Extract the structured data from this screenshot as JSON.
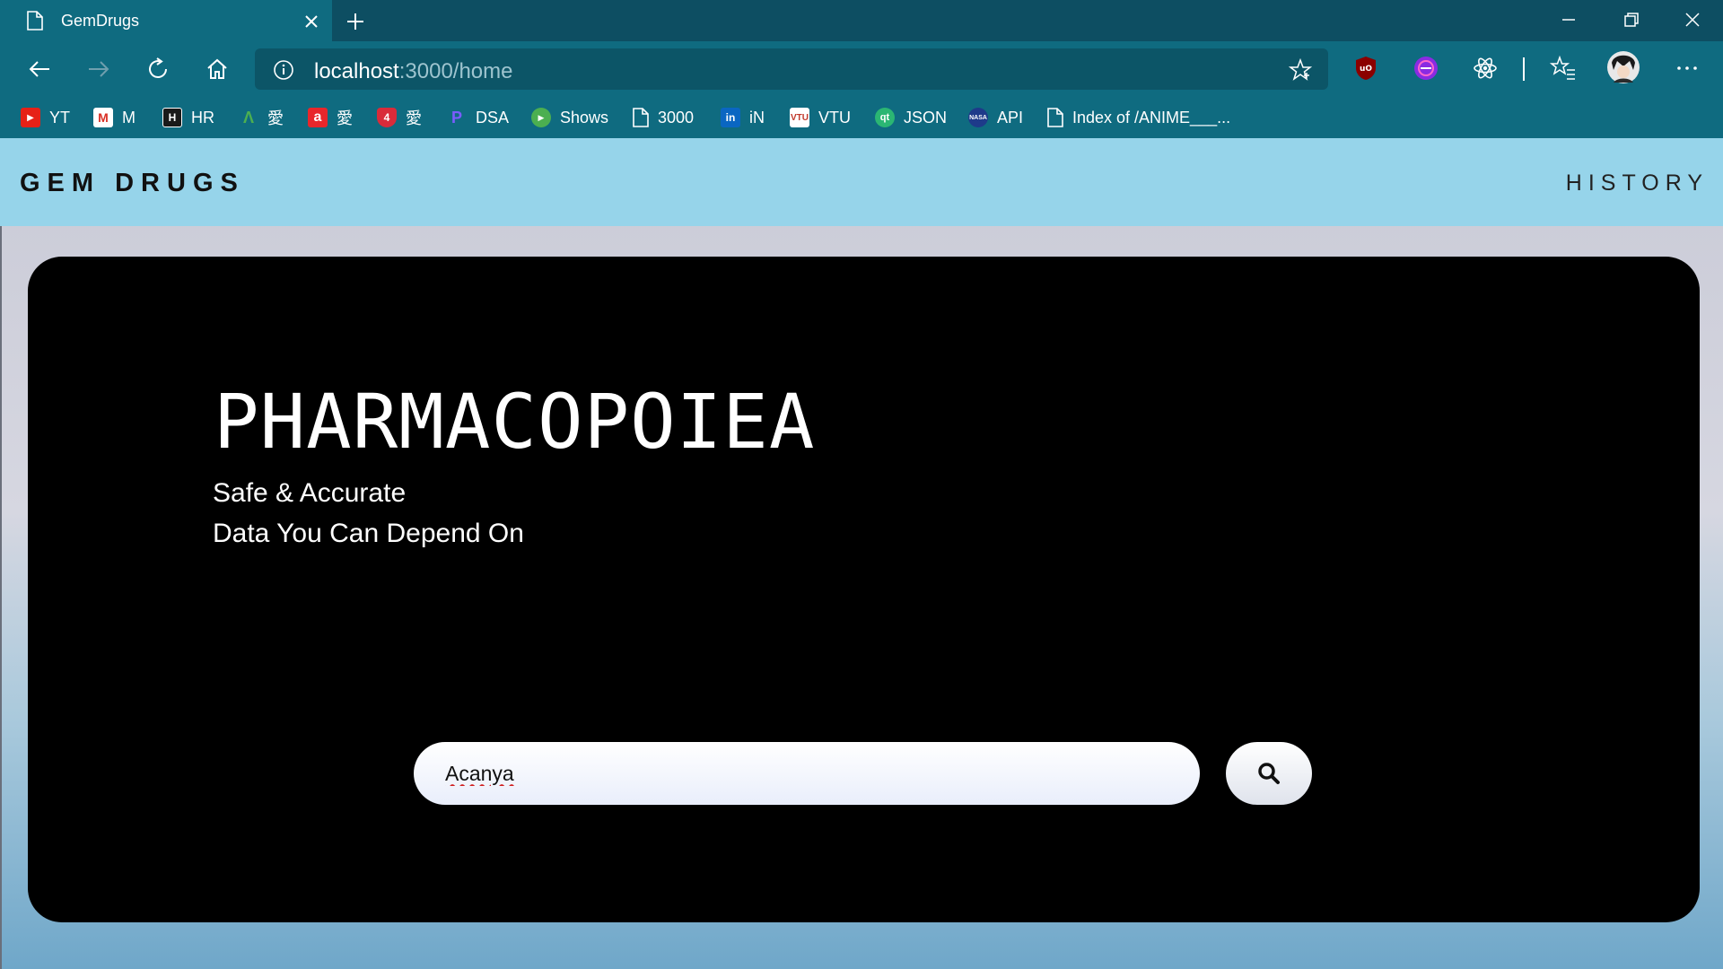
{
  "browser": {
    "tab_title": "GemDrugs",
    "url_host": "localhost",
    "url_path": ":3000/home",
    "bookmarks": [
      {
        "label": "YT",
        "icon": "youtube-icon",
        "color": "#e62117",
        "glyph": "▶"
      },
      {
        "label": "M",
        "icon": "gmail-icon",
        "color": "#ffffff",
        "glyph": "M"
      },
      {
        "label": "HR",
        "icon": "hackerrank-icon",
        "color": "#1a1a1a",
        "glyph": "H"
      },
      {
        "label": "愛",
        "icon": "anime-a-icon",
        "color": "#2a7a4a",
        "glyph": "Λ"
      },
      {
        "label": "愛",
        "icon": "anime-red-a-icon",
        "color": "#e8262b",
        "glyph": "a"
      },
      {
        "label": "愛",
        "icon": "anime-shield-icon",
        "color": "#d92b3a",
        "glyph": "4"
      },
      {
        "label": "DSA",
        "icon": "dsa-icon",
        "color": "#5a3ad8",
        "glyph": "P"
      },
      {
        "label": "Shows",
        "icon": "shows-icon",
        "color": "#4caf50",
        "glyph": "▶"
      },
      {
        "label": "3000",
        "icon": "page-icon",
        "color": "transparent",
        "glyph": ""
      },
      {
        "label": "iN",
        "icon": "linkedin-icon",
        "color": "#0a66c2",
        "glyph": "in"
      },
      {
        "label": "VTU",
        "icon": "vtu-icon",
        "color": "#ffffff",
        "glyph": "V"
      },
      {
        "label": "JSON",
        "icon": "json-qt-icon",
        "color": "#2bb673",
        "glyph": "qt"
      },
      {
        "label": "API",
        "icon": "nasa-icon",
        "color": "#1e3a8a",
        "glyph": "N"
      },
      {
        "label": "Index of /ANIME___...",
        "icon": "page-icon",
        "color": "transparent",
        "glyph": ""
      }
    ]
  },
  "site": {
    "brand": "GEM DRUGS",
    "nav_history": "HISTORY",
    "hero": {
      "title": "PHARMACOPOIEA",
      "subtitle_line1": "Safe & Accurate",
      "subtitle_line2": "Data You Can Depend On"
    },
    "search": {
      "value": "Acanya"
    }
  }
}
